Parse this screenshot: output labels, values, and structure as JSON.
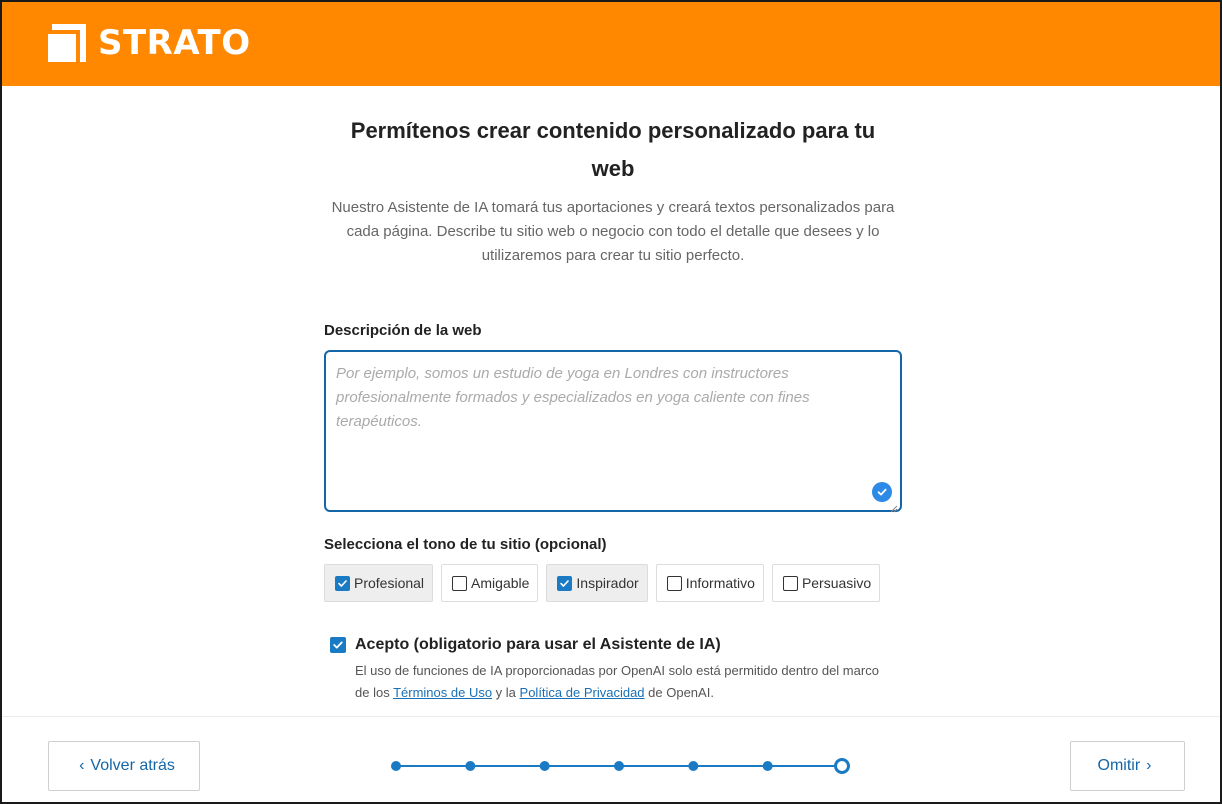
{
  "brand": {
    "name": "STRATO",
    "color": "#ff8800"
  },
  "page": {
    "title": "Permítenos crear contenido personalizado para tu web",
    "subtitle": "Nuestro Asistente de IA tomará tus aportaciones y creará textos personalizados para cada página. Describe tu sitio web o negocio con todo el detalle que desees y lo utilizaremos para crear tu sitio perfecto."
  },
  "description": {
    "label": "Descripción de la web",
    "placeholder": "Por ejemplo, somos un estudio de yoga en Londres con instructores profesionalmente formados y especializados en yoga caliente con fines terapéuticos.",
    "value": ""
  },
  "tone": {
    "label": "Selecciona el tono de tu sitio (opcional)",
    "options": [
      {
        "label": "Profesional",
        "checked": true
      },
      {
        "label": "Amigable",
        "checked": false
      },
      {
        "label": "Inspirador",
        "checked": true
      },
      {
        "label": "Informativo",
        "checked": false
      },
      {
        "label": "Persuasivo",
        "checked": false
      }
    ]
  },
  "consent": {
    "label": "Acepto (obligatorio para usar el Asistente de IA)",
    "checked": true,
    "note_before": "El uso de funciones de IA proporcionadas por OpenAI solo está permitido dentro del marco de los ",
    "terms_link": "Términos de Uso",
    "note_middle": " y la ",
    "privacy_link": "Política de Privacidad",
    "note_after": " de OpenAI."
  },
  "footer": {
    "back_label": "Volver atrás",
    "skip_label": "Omitir",
    "steps_total": 7,
    "current_step": 7
  },
  "colors": {
    "accent": "#1a7bc4",
    "link": "#1466a8",
    "focus_border": "#1466a8"
  }
}
